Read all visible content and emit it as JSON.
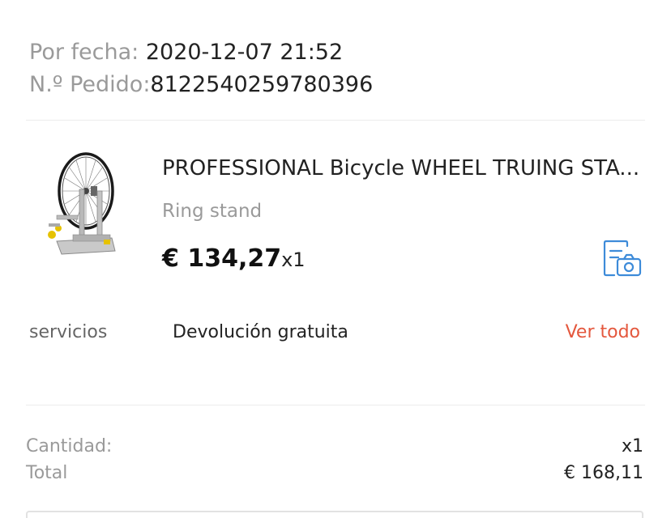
{
  "order": {
    "date_label": "Por fecha:",
    "date_value": "2020-12-07 21:52",
    "number_label": "N.º Pedido:",
    "number_value": "8122540259780396"
  },
  "product": {
    "image_icon": "bicycle-wheel-truing-stand-image",
    "title": "PROFESSIONAL Bicycle WHEEL TRUING STA...",
    "variant": "Ring stand",
    "price": "€ 134,27",
    "quantity": "x1",
    "photo_button_icon": "photo-review-icon"
  },
  "services": {
    "label": "servicios",
    "value": "Devolución gratuita",
    "link": "Ver todo"
  },
  "summary": {
    "quantity_label": "Cantidad:",
    "quantity_value": "x1",
    "total_label": "Total",
    "total_value": "€ 168,11"
  },
  "colors": {
    "accent_link": "#e4573d",
    "icon_blue": "#3d8bd9",
    "muted_text": "#9a9a9a",
    "primary_text": "#222222"
  }
}
